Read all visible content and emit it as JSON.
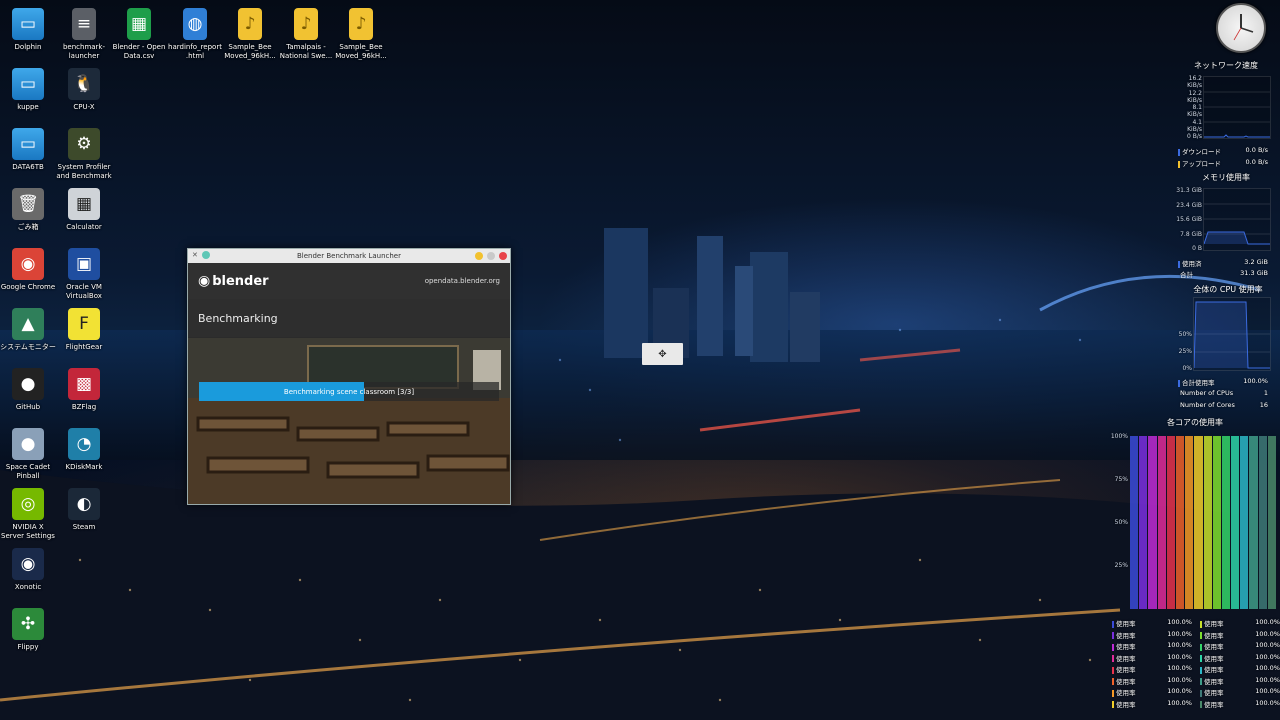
{
  "desktop_icons": [
    {
      "label": "Dolphin",
      "icon": "folder-icon"
    },
    {
      "label": "benchmark-launcher",
      "icon": "file-icon"
    },
    {
      "label": "Blender - Open Data.csv",
      "icon": "spreadsheet-icon"
    },
    {
      "label": "hardinfo_report.html",
      "icon": "html-file-icon"
    },
    {
      "label": "Sample_Bee Moved_96kH...",
      "icon": "audio-file-icon"
    },
    {
      "label": "Tamalpais - National Swe...",
      "icon": "audio-file-icon"
    },
    {
      "label": "Sample_Bee Moved_96kH...",
      "icon": "audio-file-icon"
    },
    {
      "label": "kuppe",
      "icon": "folder-icon"
    },
    {
      "label": "CPU-X",
      "icon": "cpu-x-icon"
    },
    {
      "label": "DATA6TB",
      "icon": "folder-icon"
    },
    {
      "label": "System Profiler and Benchmark",
      "icon": "system-profiler-icon"
    },
    {
      "label": "ごみ箱",
      "icon": "trash-icon"
    },
    {
      "label": "Calculator",
      "icon": "calculator-icon"
    },
    {
      "label": "Google Chrome",
      "icon": "chrome-icon"
    },
    {
      "label": "Oracle VM VirtualBox",
      "icon": "virtualbox-icon"
    },
    {
      "label": "システムモニター",
      "icon": "system-monitor-icon"
    },
    {
      "label": "FlightGear",
      "icon": "flightgear-icon"
    },
    {
      "label": "GitHub",
      "icon": "github-icon"
    },
    {
      "label": "BZFlag",
      "icon": "bzflag-icon"
    },
    {
      "label": "Space Cadet Pinball",
      "icon": "pinball-icon"
    },
    {
      "label": "KDiskMark",
      "icon": "kdiskmark-icon"
    },
    {
      "label": "NVIDIA X Server Settings",
      "icon": "nvidia-icon"
    },
    {
      "label": "Steam",
      "icon": "steam-icon"
    },
    {
      "label": "Xonotic",
      "icon": "xonotic-icon"
    },
    {
      "label": "Flippy",
      "icon": "flippy-icon"
    }
  ],
  "blender_window": {
    "title": "Blender Benchmark Launcher",
    "logo_text": "blender",
    "site": "opendata.blender.org",
    "status_heading": "Benchmarking",
    "progress_text": "Benchmarking scene classroom [3/3]",
    "progress_fraction": 0.55
  },
  "monitor": {
    "network": {
      "title": "ネットワーク速度",
      "axis": [
        "16.2 KiB/s",
        "12.2 KiB/s",
        "8.1 KiB/s",
        "4.1 KiB/s",
        "0 B/s"
      ],
      "download_label": "ダウンロード",
      "download_value": "0.0 B/s",
      "upload_label": "アップロード",
      "upload_value": "0.0 B/s"
    },
    "memory": {
      "title": "メモリ使用率",
      "axis": [
        "31.3 GiB",
        "23.4 GiB",
        "15.6 GiB",
        "7.8 GiB",
        "0 B"
      ],
      "used_label": "使用済",
      "used_value": "3.2 GiB",
      "total_label": "合計",
      "total_value": "31.3 GiB"
    },
    "cpu": {
      "title": "全体の CPU 使用率",
      "axis": [
        "50%",
        "25%",
        "0%"
      ],
      "total_label": "合計使用率",
      "total_value": "100.0%",
      "num_cpus_label": "Number of CPUs",
      "num_cpus_value": "1",
      "num_cores_label": "Number of Cores",
      "num_cores_value": "16"
    },
    "cores": {
      "title": "各コアの使用率",
      "axis": [
        "100%",
        "75%",
        "50%",
        "25%"
      ],
      "colors": [
        "#3b4bd8",
        "#7a2fe0",
        "#c02bd6",
        "#e02b9a",
        "#e8334d",
        "#f0622a",
        "#f79a26",
        "#f2cf2a",
        "#c8e02b",
        "#7fe02f",
        "#34d66a",
        "#2ed6a8",
        "#2bb8c8",
        "#3f9e8a",
        "#3e7a78",
        "#4a8a6a"
      ],
      "usage_label": "使用率",
      "usage_value": "100.0%"
    }
  }
}
